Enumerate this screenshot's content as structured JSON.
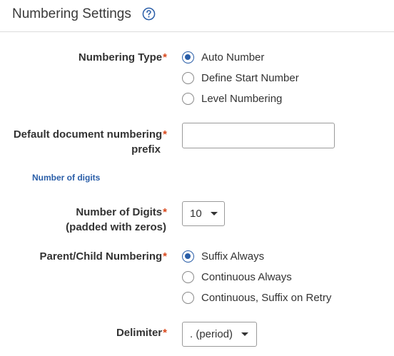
{
  "header": {
    "title": "Numbering Settings",
    "help_icon": "help-circle-icon"
  },
  "numbering_type": {
    "label": "Numbering Type",
    "required": "*",
    "options": [
      {
        "label": "Auto Number",
        "checked": true
      },
      {
        "label": "Define Start Number",
        "checked": false
      },
      {
        "label": "Level Numbering",
        "checked": false
      }
    ]
  },
  "prefix": {
    "label_line1": "Default document numbering",
    "label_line2": "prefix",
    "required": "*",
    "value": "",
    "placeholder": ""
  },
  "section_link": {
    "label": "Number of digits"
  },
  "digits": {
    "label_line1": "Number of Digits",
    "label_line2": "(padded with zeros)",
    "required": "*",
    "value": "10"
  },
  "parent_child": {
    "label": "Parent/Child Numbering",
    "required": "*",
    "options": [
      {
        "label": "Suffix Always",
        "checked": true
      },
      {
        "label": "Continuous Always",
        "checked": false
      },
      {
        "label": "Continuous, Suffix on Retry",
        "checked": false
      }
    ]
  },
  "delimiter": {
    "label": "Delimiter",
    "required": "*",
    "value": ". (period)"
  },
  "colors": {
    "accent": "#2a5ea8",
    "required": "#d9481c",
    "divider": "#dcdcdc"
  }
}
